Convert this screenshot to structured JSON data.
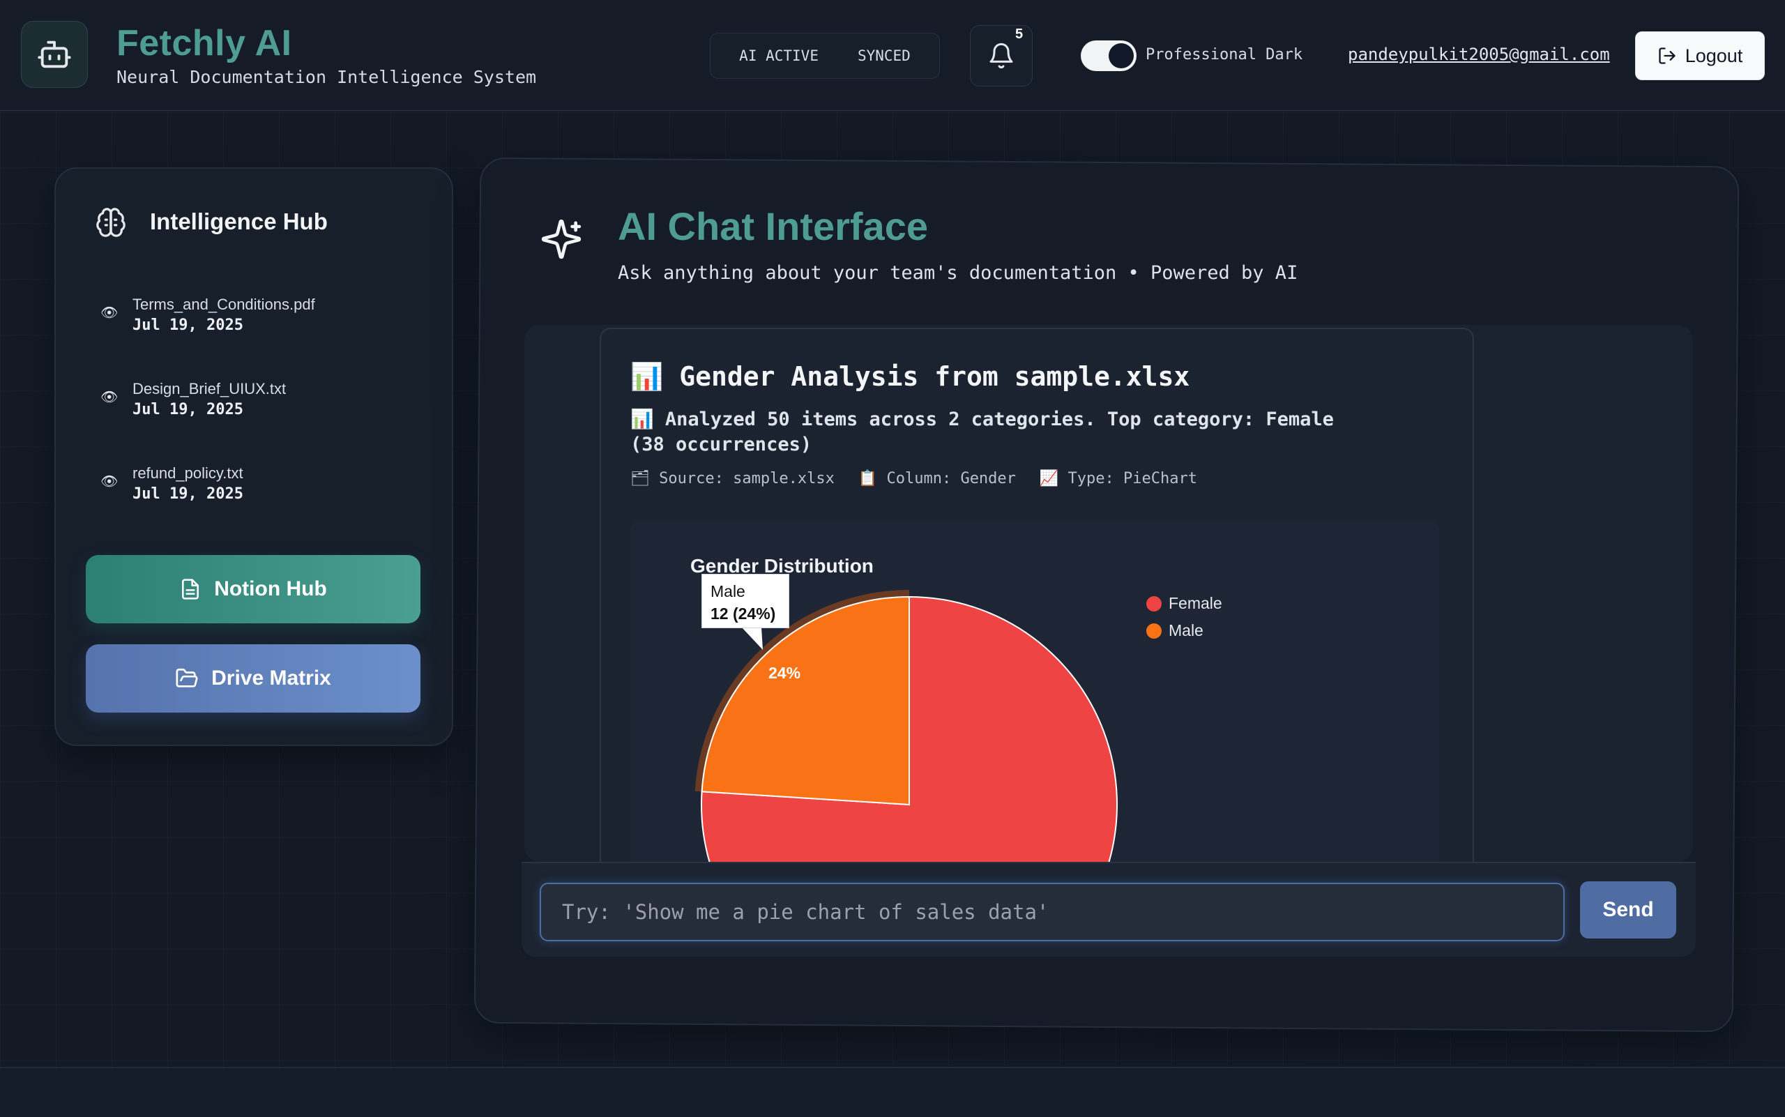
{
  "header": {
    "title": "Fetchly AI",
    "subtitle": "Neural Documentation Intelligence System",
    "status": [
      "AI ACTIVE",
      "SYNCED"
    ],
    "notification_count": "5",
    "theme_label": "Professional Dark",
    "theme_toggle_on": true,
    "email": "pandeypulkit2005@gmail.com",
    "logout_label": "Logout"
  },
  "sidebar": {
    "title": "Intelligence Hub",
    "documents": [
      {
        "name": "Terms_and_Conditions.pdf",
        "date": "Jul 19, 2025",
        "icon": "eye-emoji"
      },
      {
        "name": "Design_Brief_UIUX.txt",
        "date": "Jul 19, 2025",
        "icon": "eye-emoji"
      },
      {
        "name": "refund_policy.txt",
        "date": "Jul 19, 2025",
        "icon": "eye-emoji"
      }
    ],
    "notion_button": "Notion Hub",
    "drive_button": "Drive Matrix"
  },
  "chat": {
    "title": "AI Chat Interface",
    "subtitle": "Ask anything about your team's documentation • Powered by AI",
    "message": {
      "title": "📊 Gender Analysis from sample.xlsx",
      "text": "📊 Analyzed 50 items across 2 categories. Top category: Female (38 occurrences)",
      "meta": [
        "🗂 Source: sample.xlsx",
        "📋 Column: Gender",
        "📈 Type: PieChart"
      ]
    },
    "input_placeholder": "Try: 'Show me a pie chart of sales data'",
    "send_label": "Send"
  },
  "chart_data": {
    "type": "pie",
    "title": "Gender Distribution",
    "categories": [
      "Female",
      "Male"
    ],
    "values": [
      38,
      12
    ],
    "colors": [
      "#ef4444",
      "#f97316"
    ],
    "legend_position": "right",
    "visible_slice_labels": [
      "24%"
    ],
    "tooltip": {
      "label": "Male",
      "value": "12 (24%)"
    }
  }
}
